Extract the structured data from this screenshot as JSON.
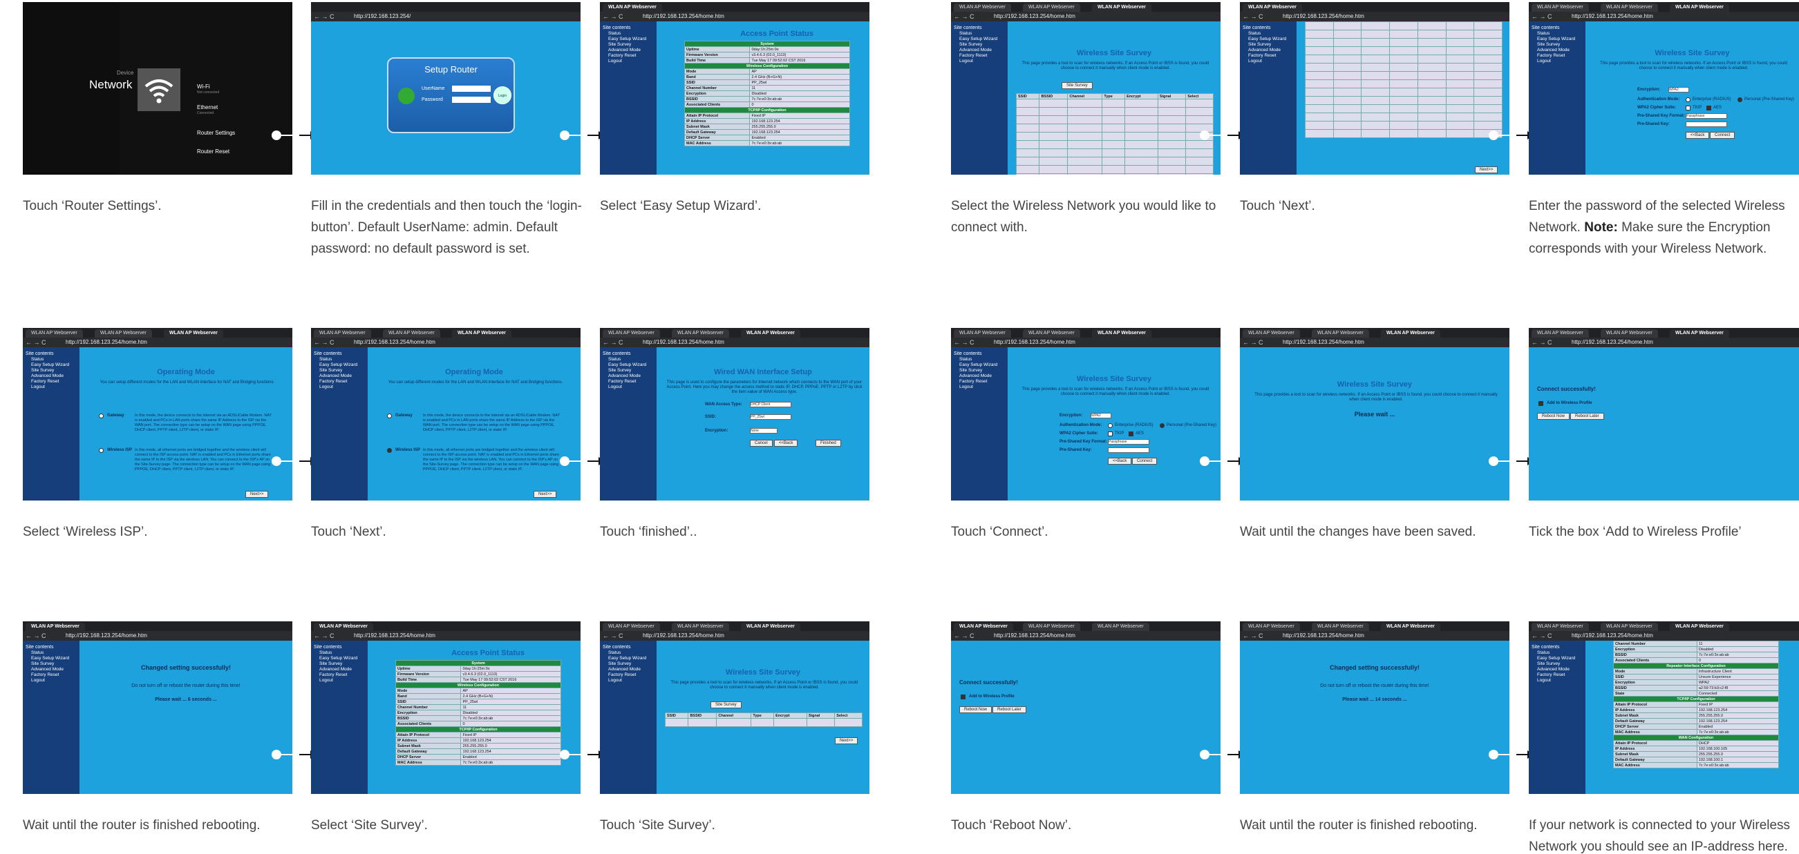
{
  "browser": {
    "tab_title": "WLAN AP Webserver",
    "url": "http://192.168.123.254/home.htm",
    "url_login": "http://192.168.123.254/",
    "nav": "← → C"
  },
  "sidebar": {
    "root": "Site contents",
    "items": [
      "Status",
      "Easy Setup Wizard",
      "Site Survey",
      "Advanced Mode",
      "Factory Reset",
      "Logout"
    ]
  },
  "device": {
    "label": "Device",
    "network": "Network",
    "menu": [
      "Wi-Fi",
      "Ethernet",
      "Router Settings",
      "Router Reset"
    ],
    "sub": [
      "Not connected",
      "Connected"
    ]
  },
  "login": {
    "title": "Setup Router",
    "user_label": "UserName",
    "pass_label": "Password",
    "btn": "Login"
  },
  "pages": {
    "ap_status": "Access Point Status",
    "survey": "Wireless Site Survey",
    "op_mode": "Operating Mode",
    "wan": "Wired WAN Interface Setup",
    "connect_ok": "Connect successfully!",
    "changed": "Changed setting successfully!",
    "no_reboot": "Do not turn off or reboot the router during this time!",
    "wait6": "Please wait ... 6  seconds ...",
    "wait14": "Please wait ... 14  seconds ...",
    "please_wait": "Please wait ...",
    "survey_desc": "This page provides a tool to scan for wireless networks. If an Access Point or IBSS is found, you could choose to connect it manually when client mode is enabled.",
    "op_desc": "You can setup different modes for the LAN and WLAN interface for NAT and Bridging functions.",
    "wan_desc": "This page is used to configure the parameters for Internet network which connects to the WAN port of your Access Point. Here you may change the access method to static IP, DHCP, PPPoE, PPTP or L2TP by click the item value of WAN Access type.",
    "gateway": "Gateway",
    "wireless_isp": "Wireless ISP",
    "gw_text": "In this mode, the device connects to the internet via an ADSL/Cable Modem. NAT is enabled and PCs in LAN ports share the same IP Address to the ISP via the WAN port. The connection type can be setup on the WAN page using PPPOE, DHCP client, PPTP client, L2TP client, or static IP.",
    "isp_text": "In this mode, all ethernet ports are bridged together and the wireless client will connect to the ISP access point. NAT is enabled and PCs in Ethernet ports share the same IP to the ISP via the wireless LAN. You can connect to the ISP's AP on the Site-Survey page. The connection type can be setup on the WAN page using PPPOE, DHCP client, PPTP client, L2TP client, or static IP.",
    "next": "Next>>",
    "back": "<<Back",
    "cancel": "Cancel",
    "finished": "Finished",
    "connect": "Connect",
    "site_survey_btn": "Site Survey",
    "add_profile": "Add to Wireless Profile",
    "reboot_now": "Reboot Now",
    "reboot_later": "Reboot Later",
    "encryption": "Encryption:",
    "enc_val": "WPA2",
    "auth_mode": "Authentication Mode:",
    "auth_ent": "Enterprise (RADIUS)",
    "auth_per": "Personal (Pre-Shared Key)",
    "cipher": "WPA2 Cipher Suite:",
    "tkip": "TKIP",
    "aes": "AES",
    "psk_format": "Pre-Shared Key Format:",
    "passphrase": "Passphrase",
    "psk": "Pre-Shared Key:",
    "wan_type": "WAN Access Type:",
    "dhcp": "DHCP Client",
    "ssid": "SSID:",
    "ssid_val": "PP_25wl",
    "none": "None"
  },
  "survey_cols": [
    "SSID",
    "BSSID",
    "Channel",
    "Type",
    "Encrypt",
    "Signal",
    "Select"
  ],
  "status_rows": [
    {
      "l": "System",
      "v": "",
      "h": true
    },
    {
      "l": "Uptime",
      "v": "0day:1h:25m:9s"
    },
    {
      "l": "Firmware Version",
      "v": "v3.4.6.3 (02.0_1113)"
    },
    {
      "l": "Build Time",
      "v": "Tue May 17 09:52:02 CST 2016"
    },
    {
      "l": "Wireless Configuration",
      "v": "",
      "h": true
    },
    {
      "l": "Mode",
      "v": "AP"
    },
    {
      "l": "Band",
      "v": "2.4 GHz (B+G+N)"
    },
    {
      "l": "SSID",
      "v": "PP_25wl"
    },
    {
      "l": "Channel Number",
      "v": "11"
    },
    {
      "l": "Encryption",
      "v": "Disabled"
    },
    {
      "l": "BSSID",
      "v": "7c:7e:e0:3x:ab:ab"
    },
    {
      "l": "Associated Clients",
      "v": "0"
    },
    {
      "l": "TCP/IP Configuration",
      "v": "",
      "h": true
    },
    {
      "l": "Attain IP Protocol",
      "v": "Fixed IP"
    },
    {
      "l": "IP Address",
      "v": "192.168.123.254"
    },
    {
      "l": "Subnet Mask",
      "v": "255.255.255.0"
    },
    {
      "l": "Default Gateway",
      "v": "192.168.123.254"
    },
    {
      "l": "DHCP Server",
      "v": "Enabled"
    },
    {
      "l": "MAC Address",
      "v": "7c:7e:e0:3x:ab:ab"
    }
  ],
  "final_rows": [
    {
      "l": "Channel Number",
      "v": "11"
    },
    {
      "l": "Encryption",
      "v": "Disabled"
    },
    {
      "l": "BSSID",
      "v": "7c:7e:e0:3x:ab:ab"
    },
    {
      "l": "Associated Clients",
      "v": "0"
    },
    {
      "l": "Repeater Interface Configuration",
      "v": "",
      "h": true
    },
    {
      "l": "Mode",
      "v": "Infrastructure Client"
    },
    {
      "l": "SSID",
      "v": "Unsure Experience"
    },
    {
      "l": "Encryption",
      "v": "WPA2"
    },
    {
      "l": "BSSID",
      "v": "a2:59:73:b3:c2:f8"
    },
    {
      "l": "State",
      "v": "Connected"
    },
    {
      "l": "TCP/IP Configuration",
      "v": "",
      "h": true
    },
    {
      "l": "Attain IP Protocol",
      "v": "Fixed IP"
    },
    {
      "l": "IP Address",
      "v": "192.168.123.254"
    },
    {
      "l": "Subnet Mask",
      "v": "255.255.255.0"
    },
    {
      "l": "Default Gateway",
      "v": "192.168.123.254"
    },
    {
      "l": "DHCP Server",
      "v": "Enabled"
    },
    {
      "l": "MAC Address",
      "v": "7c:7e:e0:3x:ab:ab"
    },
    {
      "l": "WAN Configuration",
      "v": "",
      "h": true
    },
    {
      "l": "Attain IP Protocol",
      "v": "DHCP"
    },
    {
      "l": "IP Address",
      "v": "192.168.100.105"
    },
    {
      "l": "Subnet Mask",
      "v": "255.255.255.0"
    },
    {
      "l": "Default Gateway",
      "v": "192.168.100.1"
    },
    {
      "l": "MAC Address",
      "v": "7c:7e:e0:3x:ab:ab"
    }
  ],
  "captions": {
    "c1": "Touch ‘Router Settings’.",
    "c2": "Fill in the credentials and then touch the ‘login-button’. Default UserName: admin. Default password: no default password is set.",
    "c3": "Select ‘Easy Setup Wizard’.",
    "c4": "Select ‘Wireless ISP’.",
    "c5": "Touch ‘Next’.",
    "c6": "Touch ‘finished’..",
    "c7": "Wait until the router is finished rebooting.",
    "c8": "Select ‘Site Survey’.",
    "c9": "Touch ‘Site Survey’.",
    "c10": "Select the Wireless Network you would like to connect with.",
    "c11": "Touch ‘Next’.",
    "c12a": "Enter the password of the selected Wireless Network. ",
    "c12b": "Note:",
    "c12c": " Make sure the Encryption corresponds with your Wireless Network.",
    "c13": "Touch ‘Connect’.",
    "c14": "Wait until the changes have been saved.",
    "c15": "Tick the box ‘Add to Wireless Profile’",
    "c16": "Touch ‘Reboot Now’.",
    "c17": "Wait until the router is finished rebooting.",
    "c18": "If your network is connected to your Wireless Network you should see an IP-address here."
  }
}
